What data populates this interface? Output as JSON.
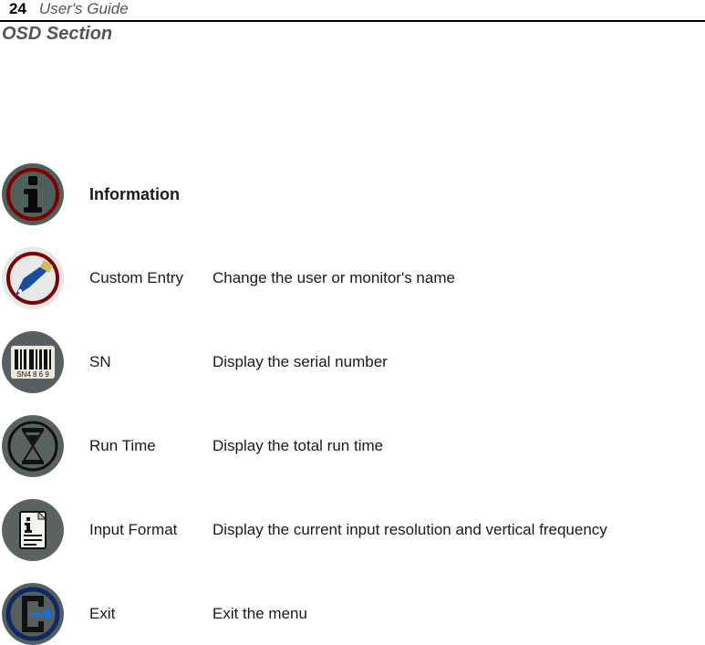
{
  "header": {
    "page_number": "24",
    "guide_title": "User's Guide",
    "section_title": "OSD Section"
  },
  "section": {
    "heading": "Information",
    "items": [
      {
        "label": "Custom Entry",
        "desc": "Change the user or monitor's name"
      },
      {
        "label": "SN",
        "desc": "Display the serial number"
      },
      {
        "label": "Run Time",
        "desc": "Display the total run time"
      },
      {
        "label": "Input Format",
        "desc": "Display the current input resolution and vertical frequency"
      },
      {
        "label": "Exit",
        "desc": "Exit the menu"
      }
    ]
  }
}
